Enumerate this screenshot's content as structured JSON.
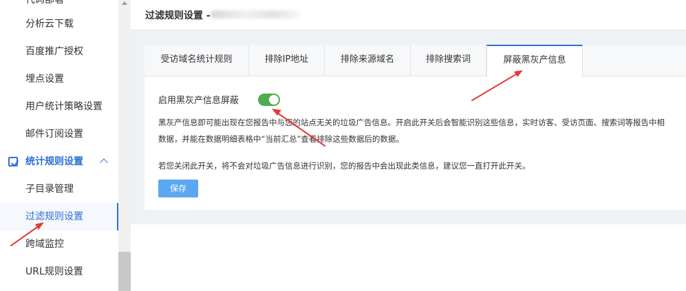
{
  "sidebar": {
    "items": [
      {
        "label": "代码部署",
        "state": "cut"
      },
      {
        "label": "分析云下载"
      },
      {
        "label": "百度推广授权"
      },
      {
        "label": "埋点设置"
      },
      {
        "label": "用户统计策略设置"
      },
      {
        "label": "邮件订阅设置"
      },
      {
        "label": "统计规则设置",
        "state": "group"
      },
      {
        "label": "子目录管理"
      },
      {
        "label": "过滤规则设置",
        "state": "active"
      },
      {
        "label": "跨域监控"
      },
      {
        "label": "URL规则设置"
      }
    ]
  },
  "header": {
    "title": "过滤规则设置 -"
  },
  "tabs": [
    {
      "label": "受访域名统计规则"
    },
    {
      "label": "排除IP地址"
    },
    {
      "label": "排除来源域名"
    },
    {
      "label": "排除搜索词"
    },
    {
      "label": "屏蔽黑灰产信息",
      "active": true
    }
  ],
  "setting": {
    "label": "启用黑灰产信息屏蔽",
    "enabled": true,
    "desc_line1": "黑灰产信息即可能出现在您报告中与您的站点无关的垃圾广告信息。开启此开关后会智能识别这些信息，实时访客、受访页面、搜索词等报告中相",
    "desc_line2": "数据，并能在数据明细表格中“当前汇总”查看排除这些数据后的数据。",
    "desc_line3": "若您关闭此开关，将不会对垃圾广告信息进行识别，您的报告中会出现此类信息，建议您一直打开此开关。"
  },
  "save_label": "保存",
  "colors": {
    "accent": "#2d6fd6",
    "toggle_on": "#4cae4c",
    "save_button": "#5aa7f2",
    "annotation": "#e53935"
  }
}
